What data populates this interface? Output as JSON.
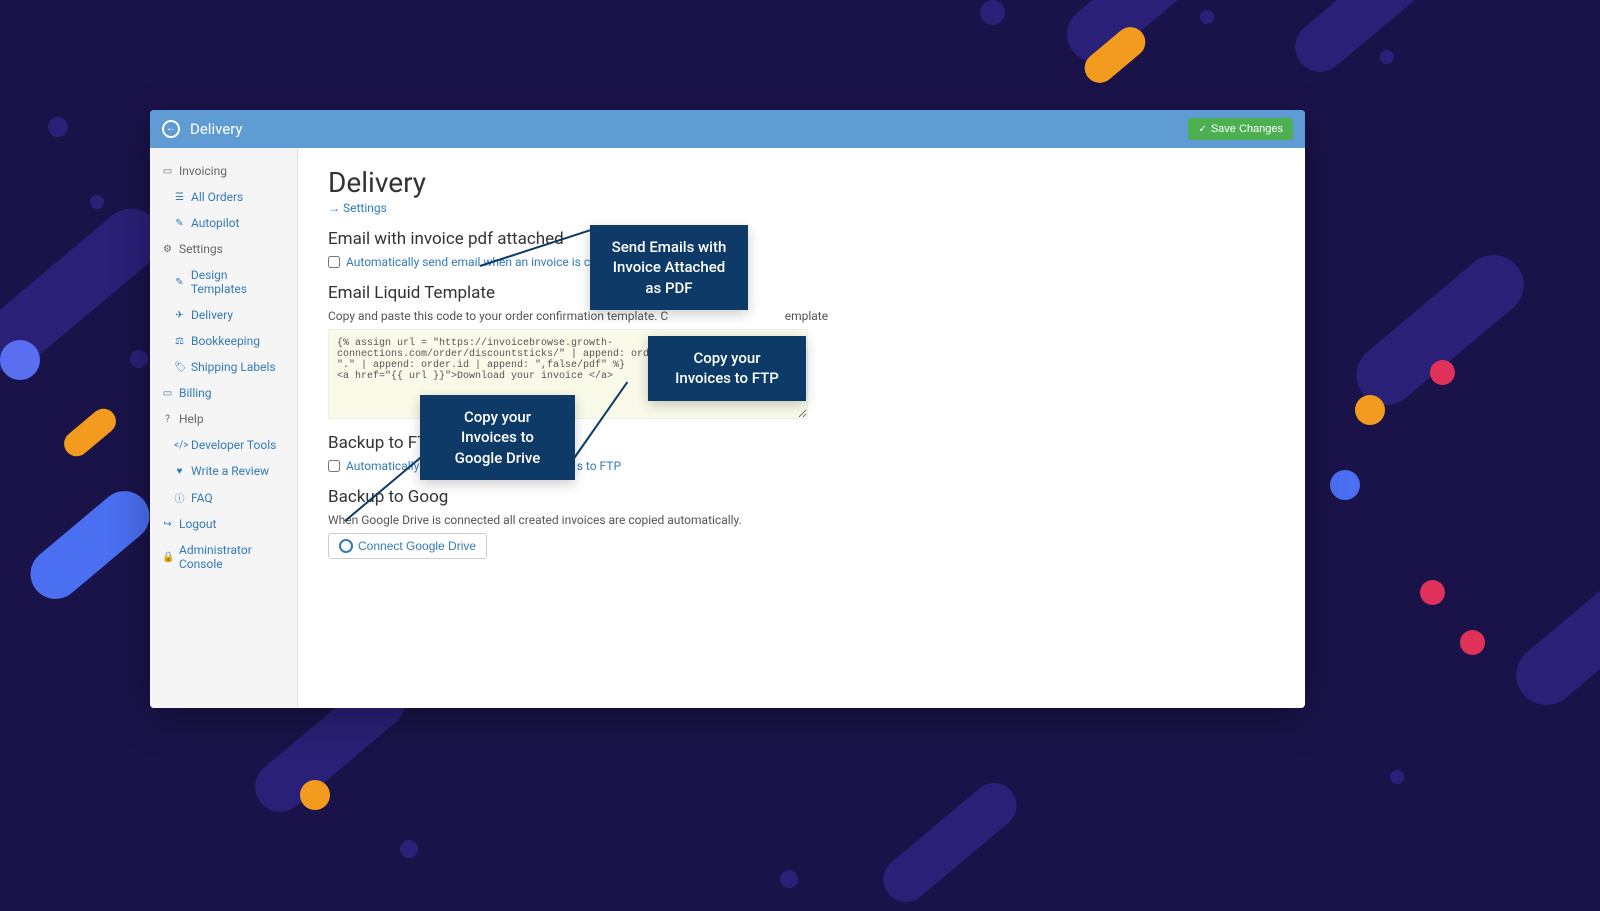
{
  "topbar": {
    "title": "Delivery",
    "save_label": "Save Changes"
  },
  "sidebar": {
    "invoicing": "Invoicing",
    "all_orders": "All Orders",
    "autopilot": "Autopilot",
    "settings": "Settings",
    "design_templates": "Design Templates",
    "delivery": "Delivery",
    "bookkeeping": "Bookkeeping",
    "shipping_labels": "Shipping Labels",
    "billing": "Billing",
    "help": "Help",
    "developer_tools": "Developer Tools",
    "write_review": "Write a Review",
    "faq": "FAQ",
    "logout": "Logout",
    "admin_console": "Administrator Console"
  },
  "main": {
    "title": "Delivery",
    "breadcrumb": "Settings",
    "section_email_attach": "Email with invoice pdf attached",
    "auto_send_email": "Automatically send email when an invoice is created.",
    "section_liquid": "Email Liquid Template",
    "liquid_help": "Copy and paste this code to your order confirmation template. C",
    "liquid_help_tail": "emplate",
    "liquid_code": "{% assign url = \"https://invoicebrowse.growth-connections.com/order/discountsticks/\" | append: order.customer.id | append: \".\" | append: order.id | append: \",false/pdf\" %}\n<a href=\"{{ url }}\">Download your invoice </a>",
    "section_ftp": "Backup to FTP",
    "auto_ftp": "Automatically copy in",
    "auto_ftp_tail": "s to FTP",
    "section_gdrive": "Backup to Goog",
    "gdrive_help": "When Google Drive is connected all created invoices are copied automatically.",
    "connect_gdrive": "Connect Google Drive"
  },
  "callouts": {
    "email": "Send Emails with Invoice Attached as PDF",
    "gdrive": "Copy your Invoices to Google Drive",
    "ftp": "Copy your Invoices to FTP"
  }
}
